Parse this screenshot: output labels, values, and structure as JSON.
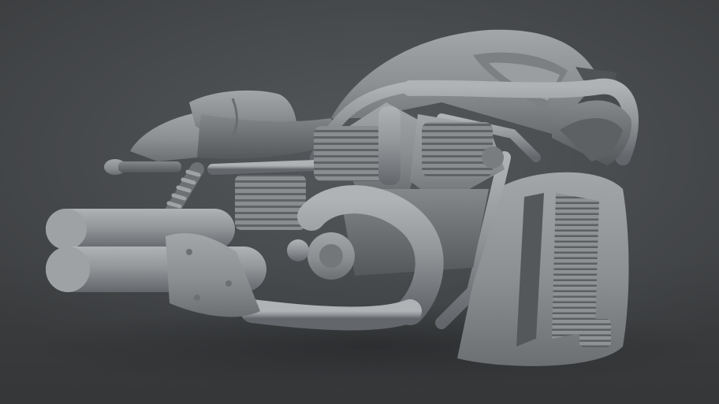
{
  "scene": {
    "subject": "motorcycle-clay-render",
    "background_color": "#45484b",
    "model_color": "#8e9194",
    "shadow_color": "#2e3032"
  }
}
